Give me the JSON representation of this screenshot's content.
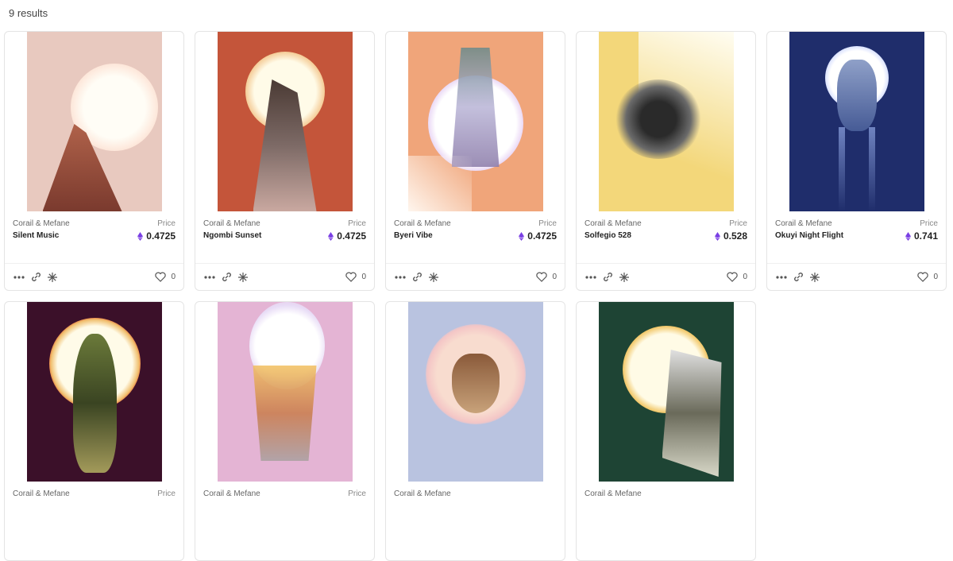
{
  "results": {
    "count_text": "9 results"
  },
  "cards": [
    {
      "creator": "Corail & Mefane",
      "title": "Silent Music",
      "price_label": "Price",
      "price": "0.4725",
      "likes": "0",
      "bg": "#e8c9bf",
      "sun": "#fff7e8"
    },
    {
      "creator": "Corail & Mefane",
      "title": "Ngombi Sunset",
      "price_label": "Price",
      "price": "0.4725",
      "likes": "0",
      "bg": "#c4553a",
      "sun": "#fff4d0"
    },
    {
      "creator": "Corail & Mefane",
      "title": "Byeri Vibe",
      "price_label": "Price",
      "price": "0.4725",
      "likes": "0",
      "bg": "#f0a57a",
      "sun": "#fffafa"
    },
    {
      "creator": "Corail & Mefane",
      "title": "Solfegio 528",
      "price_label": "Price",
      "price": "0.528",
      "likes": "0",
      "bg": "#f3d77a",
      "sun": "#fffbe8"
    },
    {
      "creator": "Corail & Mefane",
      "title": "Okuyi Night Flight",
      "price_label": "Price",
      "price": "0.741",
      "likes": "0",
      "bg": "#1f2d6b",
      "sun": "#f4f6ff"
    },
    {
      "creator": "",
      "title": "",
      "price_label": "",
      "price": "",
      "likes": "",
      "bg": "#3b1029",
      "sun": "#fff8e0"
    },
    {
      "creator": "",
      "title": "",
      "price_label": "",
      "price": "",
      "likes": "",
      "bg": "#e4b4d4",
      "sun": "#f8f0ff"
    },
    {
      "creator": "",
      "title": "",
      "price_label": "",
      "price": "",
      "likes": "",
      "bg": "#b9c3e0",
      "sun": "#f6d8cf"
    },
    {
      "creator": "",
      "title": "",
      "price_label": "",
      "price": "",
      "likes": "",
      "bg": "#1e4434",
      "sun": "#fff6d8"
    }
  ],
  "colors": {
    "eth": "#7a3fe4"
  }
}
